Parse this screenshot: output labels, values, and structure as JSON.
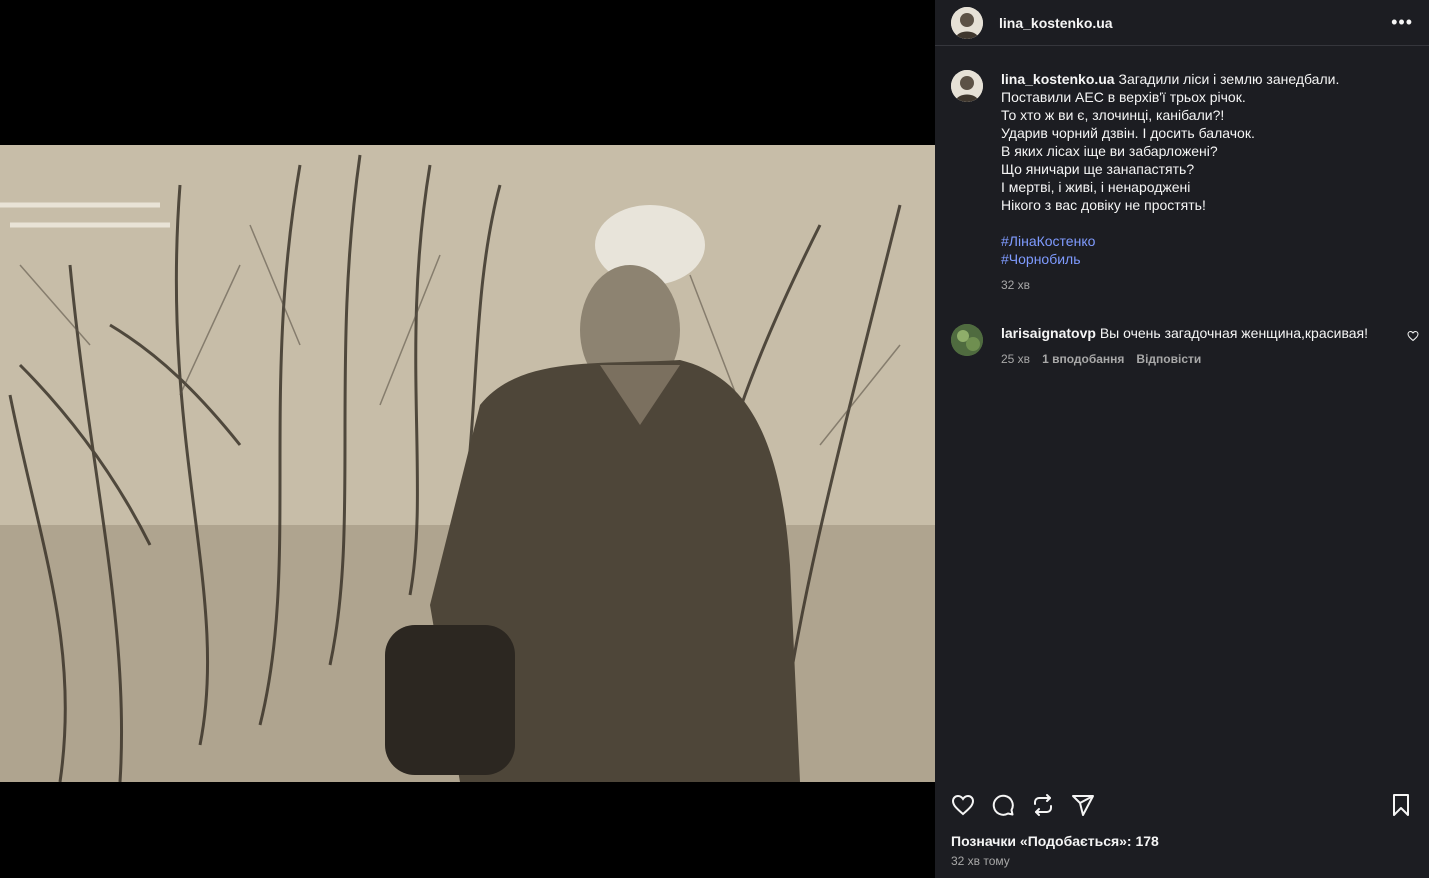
{
  "post": {
    "author": "lina_kostenko.ua",
    "caption_lines": [
      "Загадили ліси і землю занедбали.",
      "Поставили АЕС в верхів'ї трьох річок.",
      "То хто ж ви є, злочинці, канібали?!",
      "Ударив чорний дзвін. І досить балачок.",
      "В яких лісах іще ви забарложені?",
      "Що яничари ще занапастять?",
      "І мертві, і живі, і ненароджені",
      "Нікого з вас довіку не простять!"
    ],
    "hashtags": [
      "#ЛінаКостенко",
      "#Чорнобиль"
    ],
    "caption_time": "32 хв",
    "likes_text": "Позначки «Подобається»: 178",
    "posted_ago": "32 хв тому"
  },
  "comment": {
    "author": "larisaignatovp",
    "text": "Вы очень загадочная женщина,красивая!",
    "time": "25 хв",
    "likes": "1 вподобання",
    "reply": "Відповісти"
  },
  "icons": {
    "like": "heart-icon",
    "comment": "comment-icon",
    "repost": "repost-icon",
    "share": "send-icon",
    "save": "bookmark-icon",
    "more": "more-icon"
  },
  "colors": {
    "panel_bg": "#1c1d22",
    "hashtag": "#7f9bff",
    "muted": "#a8a8a8"
  }
}
